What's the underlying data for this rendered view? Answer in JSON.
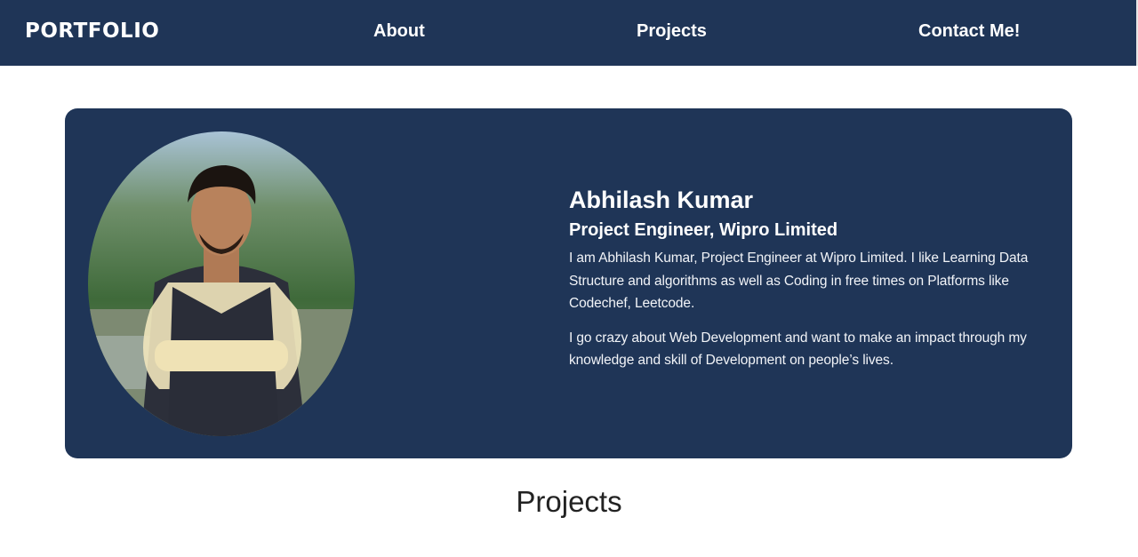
{
  "nav": {
    "brand": "PORTFOLIO",
    "links": [
      "About",
      "Projects",
      "Contact Me!"
    ]
  },
  "profile": {
    "name": "Abhilash Kumar",
    "role": "Project Engineer, Wipro Limited",
    "bio": [
      "I am Abhilash Kumar, Project Engineer at Wipro Limited. I like Learning Data Structure and algorithms as well as Coding in free times on Platforms like Codechef, Leetcode.",
      "I go crazy about Web Development and want to make an impact through my knowledge and skill of Development on people’s lives."
    ]
  },
  "projects": {
    "title": "Projects"
  },
  "colors": {
    "primary": "#1f3557"
  }
}
